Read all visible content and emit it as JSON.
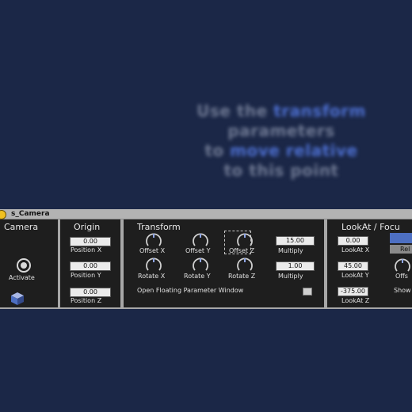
{
  "background_hint": {
    "line1_a": "Use the ",
    "line1_b": "transform",
    "line2": "parameters",
    "line3_a": "to ",
    "line3_b": "move relative",
    "line4": "to this point"
  },
  "device": {
    "title": "s_Camera",
    "camera": {
      "title": "Camera",
      "activate_label": "Activate"
    },
    "origin": {
      "title": "Origin",
      "position_x_value": "0.00",
      "position_x_label": "Position X",
      "position_y_value": "0.00",
      "position_y_label": "Position Y",
      "position_z_value": "0.00",
      "position_z_label": "Position Z"
    },
    "transform": {
      "title": "Transform",
      "offset_x_label": "Offset X",
      "offset_y_label": "Offset Y",
      "offset_z_label": "Offset Z",
      "rotate_x_label": "Rotate X",
      "rotate_y_label": "Rotate Y",
      "rotate_z_label": "Rotate Z",
      "offset_multiply_value": "15.00",
      "offset_multiply_label": "Multiply",
      "rotate_multiply_value": "1.00",
      "rotate_multiply_label": "Multiply",
      "floating_window_label": "Open Floating Parameter Window"
    },
    "lookat": {
      "title": "LookAt / Focu",
      "lookat_x_value": "0.00",
      "lookat_x_label": "LookAt X",
      "lookat_y_value": "45.00",
      "lookat_y_label": "LookAt Y",
      "lookat_z_value": "-375.00",
      "lookat_z_label": "LookAt Z",
      "rel_button_label": "Rel",
      "offs_label": "Offs",
      "show_label": "Show"
    }
  },
  "colors": {
    "background": "#1b2747",
    "panel": "#1e1e1e",
    "accent": "#4d6fc2",
    "title_dot": "#f0c020"
  }
}
